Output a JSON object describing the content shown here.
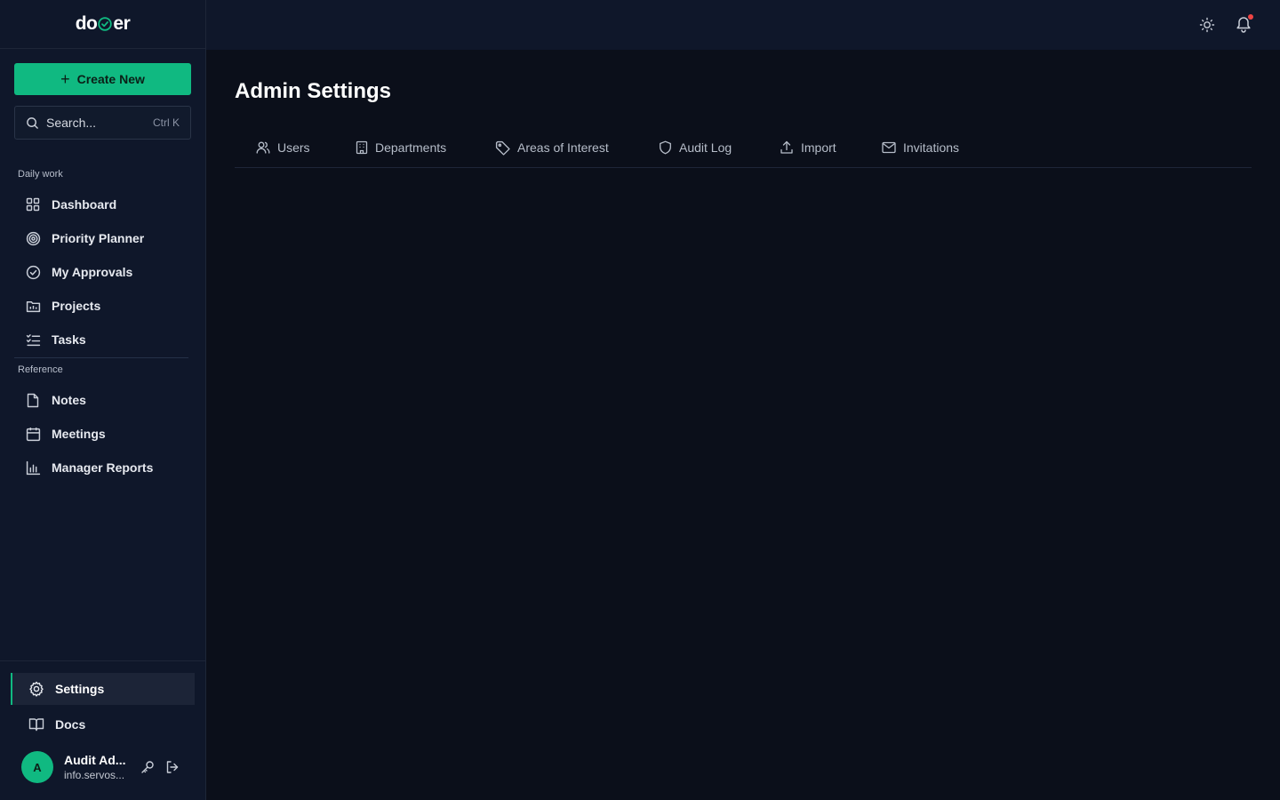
{
  "app": {
    "logo_prefix": "do",
    "logo_suffix": "er"
  },
  "sidebar": {
    "create_label": "Create New",
    "search": {
      "placeholder": "Search...",
      "shortcut": "Ctrl K"
    },
    "sections": [
      {
        "label": "Daily work"
      },
      {
        "label": "Reference"
      }
    ],
    "daily_items": [
      {
        "label": "Dashboard",
        "icon": "grid-icon"
      },
      {
        "label": "Priority Planner",
        "icon": "target-icon"
      },
      {
        "label": "My Approvals",
        "icon": "check-circle-icon"
      },
      {
        "label": "Projects",
        "icon": "folder-chart-icon"
      },
      {
        "label": "Tasks",
        "icon": "list-checks-icon"
      }
    ],
    "reference_items": [
      {
        "label": "Notes",
        "icon": "file-icon"
      },
      {
        "label": "Meetings",
        "icon": "calendar-icon"
      },
      {
        "label": "Manager Reports",
        "icon": "bar-chart-icon"
      }
    ],
    "bottom": {
      "settings_label": "Settings",
      "docs_label": "Docs"
    },
    "user": {
      "initial": "A",
      "name": "Audit Ad...",
      "email": "info.servos..."
    }
  },
  "page": {
    "title": "Admin Settings",
    "tabs": [
      {
        "label": "Users",
        "icon": "users-icon"
      },
      {
        "label": "Departments",
        "icon": "building-icon"
      },
      {
        "label": "Areas of Interest",
        "icon": "tag-icon"
      },
      {
        "label": "Audit Log",
        "icon": "shield-icon"
      },
      {
        "label": "Import",
        "icon": "upload-icon"
      },
      {
        "label": "Invitations",
        "icon": "mail-icon"
      }
    ]
  },
  "colors": {
    "accent": "#10b981",
    "notification": "#ef4444",
    "sidebar_bg": "#0f172a",
    "main_bg": "#0b0f1a"
  }
}
